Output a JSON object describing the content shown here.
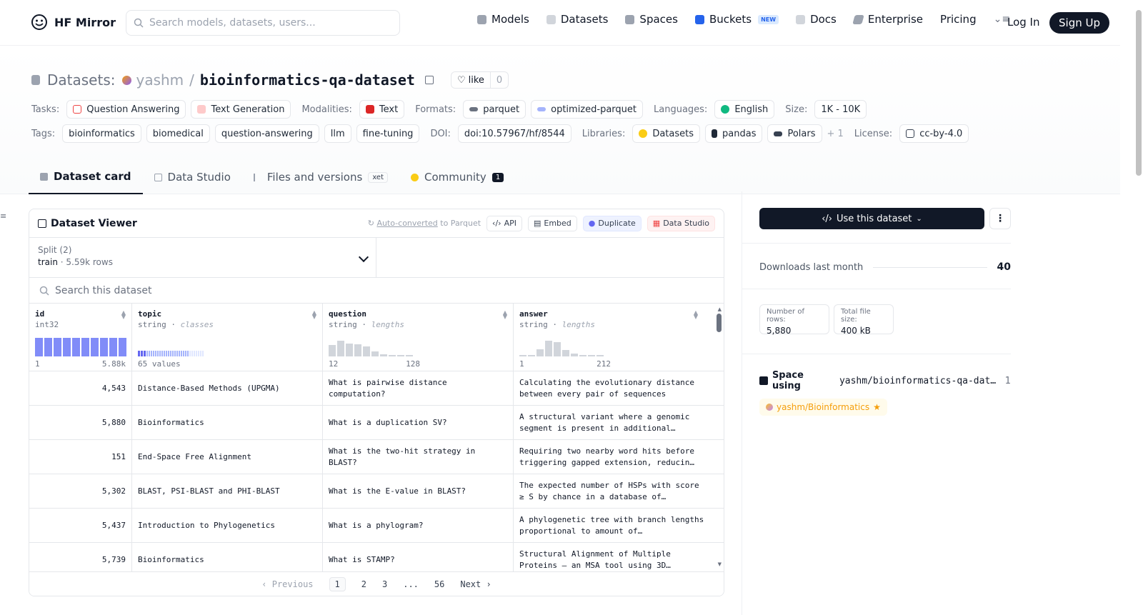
{
  "header": {
    "brand": "HF Mirror",
    "search_placeholder": "Search models, datasets, users...",
    "nav": [
      {
        "label": "Models",
        "icon": "cube-icon",
        "color": "#9ca3af"
      },
      {
        "label": "Datasets",
        "icon": "database-icon",
        "color": "#9ca3af"
      },
      {
        "label": "Spaces",
        "icon": "grid-icon",
        "color": "#9ca3af"
      },
      {
        "label": "Buckets",
        "icon": "bucket-icon",
        "color": "#2563eb"
      },
      {
        "label": "Docs",
        "icon": "book-icon",
        "color": "#9ca3af"
      },
      {
        "label": "Enterprise",
        "icon": "enterprise-icon",
        "color": "#9ca3af"
      },
      {
        "label": "Pricing"
      }
    ],
    "new_badge": "NEW",
    "login": "Log In",
    "signup": "Sign Up"
  },
  "dataset": {
    "prefix": "Datasets:",
    "owner": "yashm",
    "sep": "/",
    "name": "bioinformatics-qa-dataset",
    "like_label": "like",
    "like_count": "0"
  },
  "tags": {
    "tasks_label": "Tasks:",
    "tasks": [
      "Question Answering",
      "Text Generation"
    ],
    "modalities_label": "Modalities:",
    "modalities": [
      "Text"
    ],
    "formats_label": "Formats:",
    "formats": [
      "parquet",
      "optimized-parquet"
    ],
    "languages_label": "Languages:",
    "languages": [
      "English"
    ],
    "size_label": "Size:",
    "size": "1K - 10K",
    "tags_label": "Tags:",
    "tags": [
      "bioinformatics",
      "biomedical",
      "question-answering",
      "llm",
      "fine-tuning"
    ],
    "doi_label": "DOI:",
    "doi": "doi:10.57967/hf/8544",
    "libraries_label": "Libraries:",
    "libraries": [
      "Datasets",
      "pandas",
      "Polars"
    ],
    "more": "+ 1",
    "license_label": "License:",
    "license": "cc-by-4.0"
  },
  "tabs": [
    {
      "label": "Dataset card",
      "active": true
    },
    {
      "label": "Data Studio"
    },
    {
      "label": "Files and versions",
      "badge": "xet"
    },
    {
      "label": "Community",
      "count": "1"
    }
  ],
  "viewer": {
    "title": "Dataset Viewer",
    "auto_link": "Auto-converted",
    "auto_rest": " to Parquet",
    "api": "API",
    "embed": "Embed",
    "duplicate": "Duplicate",
    "data_studio": "Data Studio",
    "split_label": "Split (2)",
    "split_value": "train",
    "split_rows": "5.59k rows",
    "search_placeholder": "Search this dataset",
    "columns": [
      {
        "name": "id",
        "type": "int32",
        "kind": "",
        "min": "1",
        "max": "5.88k"
      },
      {
        "name": "topic",
        "type": "string",
        "kind": "classes",
        "min": "65 values",
        "max": ""
      },
      {
        "name": "question",
        "type": "string",
        "kind": "lengths",
        "min": "12",
        "max": "128"
      },
      {
        "name": "answer",
        "type": "string",
        "kind": "lengths",
        "min": "1",
        "max": "212"
      }
    ],
    "histograms": {
      "id": [
        1,
        1,
        1,
        1,
        1,
        1,
        1,
        1,
        1,
        1
      ],
      "question": [
        0.6,
        0.85,
        0.7,
        0.65,
        0.55,
        0.25,
        0.1,
        0.05,
        0.04,
        0.03
      ],
      "answer": [
        0.03,
        0.05,
        0.4,
        0.85,
        0.75,
        0.35,
        0.15,
        0.06,
        0.04,
        0.03
      ]
    },
    "rows": [
      {
        "id": "4,543",
        "topic": "Distance-Based Methods (UPGMA)",
        "question": "What is pairwise distance computation?",
        "answer": "Calculating the evolutionary distance between every pair of sequences"
      },
      {
        "id": "5,880",
        "topic": "Bioinformatics",
        "question": "What is a duplication SV?",
        "answer": "A structural variant where a genomic segment is present in additional…"
      },
      {
        "id": "151",
        "topic": "End-Space Free Alignment",
        "question": "What is the two-hit strategy in BLAST?",
        "answer": "Requiring two nearby word hits before triggering gapped extension, reducin…"
      },
      {
        "id": "5,302",
        "topic": "BLAST, PSI-BLAST and PHI-BLAST",
        "question": "What is the E-value in BLAST?",
        "answer": "The expected number of HSPs with score ≥ S by chance in a database of…"
      },
      {
        "id": "5,437",
        "topic": "Introduction to Phylogenetics",
        "question": "What is a phylogram?",
        "answer": "A phylogenetic tree with branch lengths proportional to amount of…"
      },
      {
        "id": "5,739",
        "topic": "Bioinformatics",
        "question": "What is STAMP?",
        "answer": "Structural Alignment of Multiple Proteins — an MSA tool using 3D…"
      }
    ],
    "pager": {
      "prev": "Previous",
      "pages": [
        "1",
        "2",
        "3",
        "...",
        "56"
      ],
      "next": "Next"
    }
  },
  "sidebar": {
    "use_button": "Use this dataset",
    "downloads_label": "Downloads last month",
    "downloads_value": "40",
    "rows_label": "Number of rows:",
    "rows_value": "5,880",
    "size_label": "Total file size:",
    "size_value": "400 kB",
    "space_title": "Space using",
    "space_name": "yashm/bioinformatics-qa-data…",
    "space_count": "1",
    "space_chip": "yashm/Bioinformatics"
  }
}
